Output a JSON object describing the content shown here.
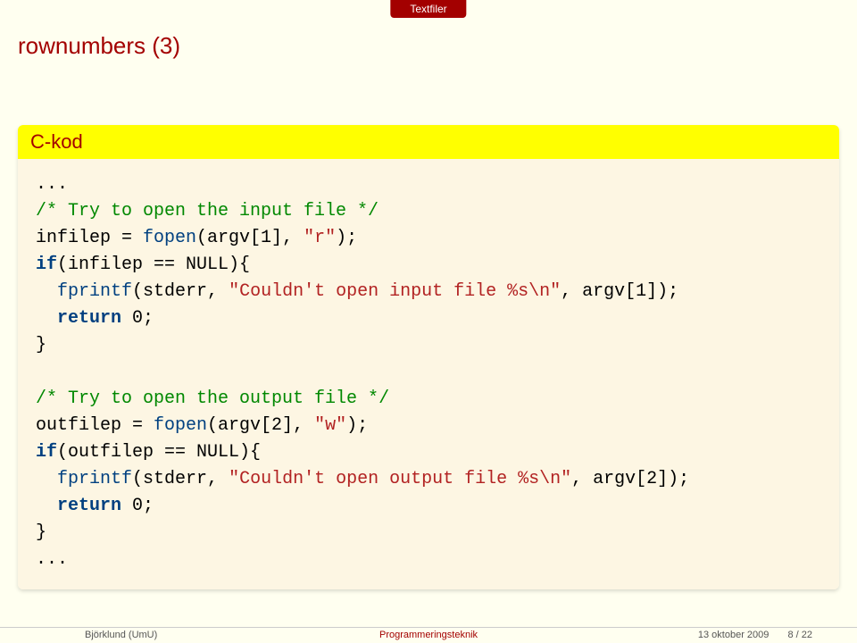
{
  "topbar": {
    "label": "Textfiler"
  },
  "title": "rownumbers (3)",
  "block": {
    "title": "C-kod"
  },
  "code": {
    "l1": "...",
    "l2a": "/* Try to open the input file */",
    "l3a": "infilep = ",
    "l3b": "fopen",
    "l3c": "(argv[1], ",
    "l3d": "\"r\"",
    "l3e": ");",
    "l4a": "if",
    "l4b": "(infilep == NULL){",
    "l5a": "  ",
    "l5b": "fprintf",
    "l5c": "(stderr, ",
    "l5d": "\"Couldn't open input file %s\\n\"",
    "l5e": ", argv[1]);",
    "l6a": "  ",
    "l6b": "return",
    "l6c": " 0;",
    "l7": "}",
    "l8": "",
    "l9a": "/* Try to open the output file */",
    "l10a": "outfilep = ",
    "l10b": "fopen",
    "l10c": "(argv[2], ",
    "l10d": "\"w\"",
    "l10e": ");",
    "l11a": "if",
    "l11b": "(outfilep == NULL){",
    "l12a": "  ",
    "l12b": "fprintf",
    "l12c": "(stderr, ",
    "l12d": "\"Couldn't open output file %s\\n\"",
    "l12e": ", argv[2]);",
    "l13a": "  ",
    "l13b": "return",
    "l13c": " 0;",
    "l14": "}",
    "l15": "..."
  },
  "footer": {
    "left": "Björklund (UmU)",
    "center": "Programmeringsteknik",
    "date": "13 oktober 2009",
    "page": "8 / 22"
  }
}
